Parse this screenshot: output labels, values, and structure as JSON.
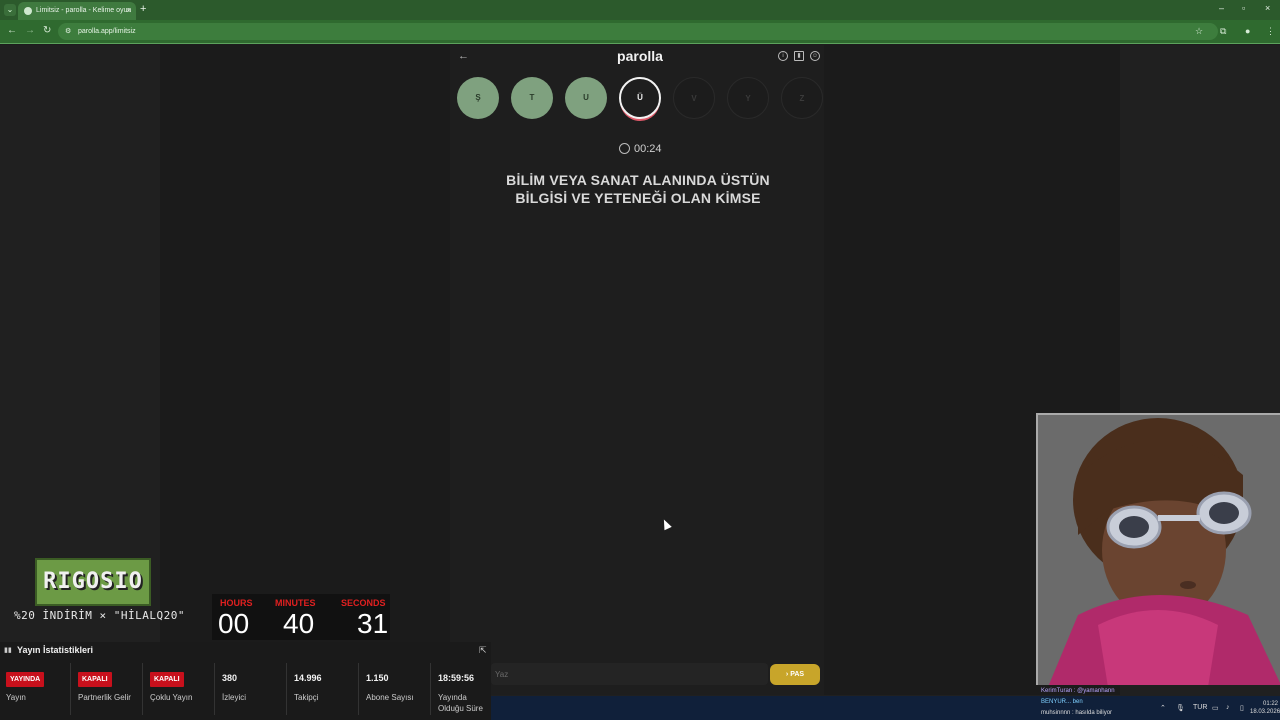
{
  "browser": {
    "tab_title": "Limitsiz - parolla - Kelime oyun",
    "url": "parolla.app/limitsiz",
    "new_tab": "+",
    "tab_close": "×",
    "win_min": "–",
    "win_max": "▫",
    "win_close": "×"
  },
  "app": {
    "title": "parolla",
    "back": "←",
    "letters": [
      {
        "char": "Ş",
        "state": "done"
      },
      {
        "char": "T",
        "state": "done"
      },
      {
        "char": "U",
        "state": "done"
      },
      {
        "char": "Ü",
        "state": "active"
      },
      {
        "char": "V",
        "state": "todo"
      },
      {
        "char": "Y",
        "state": "todo"
      },
      {
        "char": "Z",
        "state": "todo"
      }
    ],
    "timer": "00:24",
    "question_line1": "BİLİM VEYA SANAT ALANINDA ÜSTÜN",
    "question_line2": "BİLGİSİ VE YETENEĞİ OLAN KİMSE",
    "input_placeholder": "Yaz",
    "pass_label": "› PAS"
  },
  "overlay": {
    "logo_text": "RIGOSIO",
    "promo": "%20 İNDİRİM × \"HİLALQ20\"",
    "countdown": {
      "hours_label": "HOURS",
      "minutes_label": "MINUTES",
      "seconds_label": "SECONDS",
      "hours": "00",
      "minutes": "40",
      "seconds": "31"
    },
    "stats": {
      "title": "Yayın İstatistikleri",
      "items": [
        {
          "badge": "YAYINDA",
          "label": "Yayın"
        },
        {
          "badge": "KAPALI",
          "label": "Partnerlik Gelir"
        },
        {
          "badge": "KAPALI",
          "label": "Çoklu Yayın"
        },
        {
          "value": "380",
          "label": "İzleyici"
        },
        {
          "value": "14.996",
          "label": "Takipçi"
        },
        {
          "value": "1.150",
          "label": "Abone Sayısı"
        },
        {
          "value": "18:59:56",
          "label": "Yayında Olduğu Süre"
        }
      ]
    },
    "chat": [
      "KerimTuran : @yamanhann",
      "BENYUR... ben",
      "muhsinnnn : hasılda biliyor"
    ]
  },
  "taskbar": {
    "lang": "TUR",
    "time": "01:22",
    "date": "18.03.2026"
  },
  "colors": {
    "done_letter": "#7fa17f",
    "active_ring": "#e05a6a",
    "pass_button": "#c8a52a",
    "badge_red": "#c8101c",
    "browser_green": "#2f6a2f"
  }
}
